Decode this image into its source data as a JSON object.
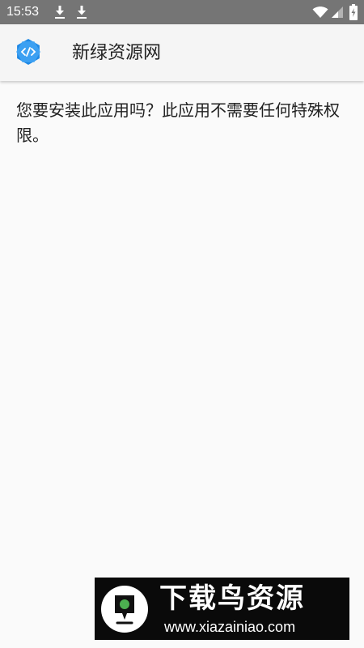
{
  "status_bar": {
    "time": "15:53",
    "icons": [
      "download-icon",
      "download-icon",
      "wifi-icon",
      "cell-signal-icon",
      "battery-charging-icon"
    ],
    "color": "#757575"
  },
  "header": {
    "app_name": "新绿资源网",
    "icon": "app-code-icon",
    "icon_color": "#1e88e5"
  },
  "content": {
    "message": "您要安装此应用吗？此应用不需要任何特殊权限。"
  },
  "watermark": {
    "title": "下载鸟资源",
    "url": "www.xiazainiao.com",
    "logo_accent": "#4caf50"
  }
}
